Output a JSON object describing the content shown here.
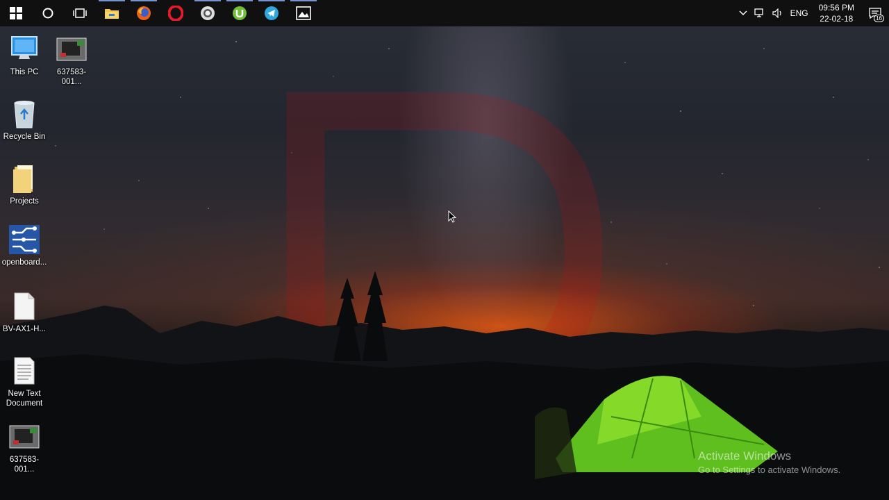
{
  "taskbar": {
    "apps": [
      {
        "icon": "windows-start-icon"
      },
      {
        "icon": "cortana-search-icon"
      },
      {
        "icon": "task-view-icon"
      },
      {
        "icon": "file-explorer-icon"
      },
      {
        "icon": "firefox-icon"
      },
      {
        "icon": "opera-icon"
      },
      {
        "icon": "chrome-like-icon"
      },
      {
        "icon": "utorrent-icon"
      },
      {
        "icon": "telegram-icon"
      },
      {
        "icon": "photos-icon"
      }
    ],
    "tray": {
      "language": "ENG",
      "time": "09:56 PM",
      "date": "22-02-18",
      "notification_count": "16"
    }
  },
  "desktop": {
    "icons": [
      {
        "label": "This PC",
        "icon": "this-pc-icon"
      },
      {
        "label": "637583-001...",
        "icon": "image-thumbnail-icon"
      },
      {
        "label": "Recycle Bin",
        "icon": "recycle-bin-icon"
      },
      {
        "label": "Projects",
        "icon": "folder-icon"
      },
      {
        "label": "openboard...",
        "icon": "openboard-icon"
      },
      {
        "label": "BV-AX1-H...",
        "icon": "blank-file-icon"
      },
      {
        "label": "New Text Document",
        "icon": "text-document-icon"
      },
      {
        "label": "637583-001...",
        "icon": "image-thumbnail-icon"
      }
    ]
  },
  "watermark": {
    "title": "Activate Windows",
    "subtitle": "Go to Settings to activate Windows."
  }
}
